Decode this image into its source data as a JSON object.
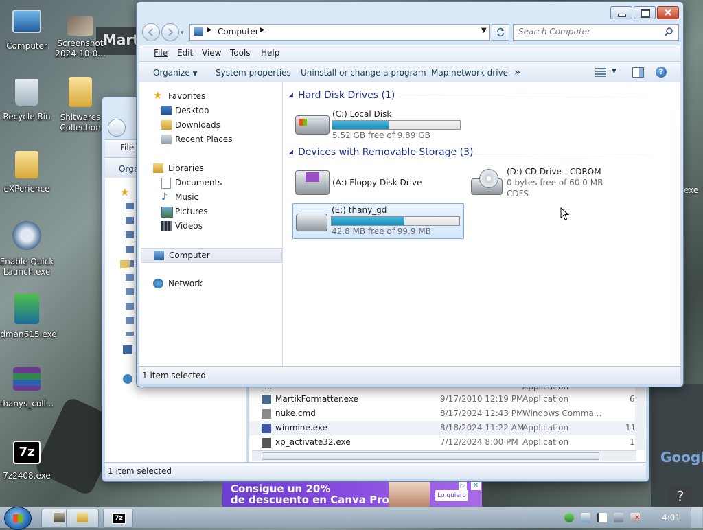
{
  "desktop": {
    "icons": [
      {
        "label": "Computer"
      },
      {
        "label": "Screenshot 2024-10-0..."
      },
      {
        "label": "Recycle Bin"
      },
      {
        "label": "Shitwares Collection"
      },
      {
        "label": "eXPerience"
      },
      {
        "label": "Enable Quick Launch.exe"
      },
      {
        "label": "idman615.exe"
      },
      {
        "label": "thanys_coll..."
      },
      {
        "label": "7z2408.exe"
      }
    ],
    "bg_title": "Martx",
    "bg_right_label": "exe",
    "help_glyph": "?",
    "google_text": "Google"
  },
  "back_window": {
    "menu_file": "File",
    "cmd_partial": "Orga",
    "status": "1 item selected",
    "rows": [
      {
        "name": "...",
        "date": "",
        "type": "Application",
        "size": ""
      },
      {
        "name": "MartikFormatter.exe",
        "date": "9/17/2010 12:19 PM",
        "type": "Application",
        "size": "6"
      },
      {
        "name": "nuke.cmd",
        "date": "8/17/2024 12:43 PM",
        "type": "Windows Comma...",
        "size": ""
      },
      {
        "name": "winmine.exe",
        "date": "8/18/2024 11:22 AM",
        "type": "Application",
        "size": "11"
      },
      {
        "name": "xp_activate32.exe",
        "date": "7/12/2024 8:00 PM",
        "type": "Application",
        "size": "1"
      }
    ]
  },
  "explorer": {
    "address": "Computer",
    "search_placeholder": "Search Computer",
    "menu": {
      "file": "File",
      "edit": "Edit",
      "view": "View",
      "tools": "Tools",
      "help": "Help"
    },
    "commands": {
      "organize": "Organize",
      "system_properties": "System properties",
      "uninstall": "Uninstall or change a program",
      "map_drive": "Map network drive",
      "more": "»"
    },
    "nav": {
      "favorites": "Favorites",
      "desktop": "Desktop",
      "downloads": "Downloads",
      "recent": "Recent Places",
      "libraries": "Libraries",
      "documents": "Documents",
      "music": "Music",
      "pictures": "Pictures",
      "videos": "Videos",
      "computer": "Computer",
      "network": "Network"
    },
    "groups": {
      "hdd": "Hard Disk Drives (1)",
      "removable": "Devices with Removable Storage (3)"
    },
    "drives": {
      "c": {
        "name": "(C:) Local Disk",
        "free": "5.52 GB free of 9.89 GB",
        "used_fraction": 0.44
      },
      "a": {
        "name": "(A:) Floppy Disk Drive"
      },
      "d": {
        "name": "(D:) CD Drive - CDROM",
        "free": "0 bytes free of 60.0 MB",
        "fs": "CDFS"
      },
      "e": {
        "name": "(E:) thany_gd",
        "free": "42.8 MB free of 99.9 MB",
        "used_fraction": 0.57
      }
    },
    "status": "1 item selected"
  },
  "ad": {
    "line1": "Consigue un 20%",
    "line2": "de descuento en Canva Pro",
    "button": "Lo quiero"
  },
  "taskbar": {
    "clock": "4:01",
    "seven_zip": "7z"
  }
}
